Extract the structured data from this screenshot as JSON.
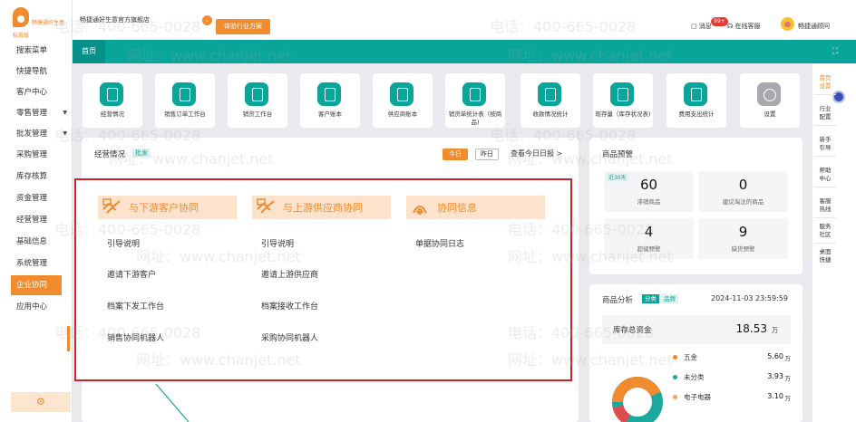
{
  "brand": {
    "name": "畅捷通好生意",
    "sub": "标准版",
    "accent": "#f08b2e",
    "teal": "#0aa59a"
  },
  "sidebar": {
    "items": [
      {
        "label": "搜索菜单",
        "arrow": ""
      },
      {
        "label": "快捷导航",
        "arrow": ""
      },
      {
        "label": "客户中心",
        "arrow": ""
      },
      {
        "label": "零售管理",
        "arrow": "▼"
      },
      {
        "label": "批发管理",
        "arrow": "▼"
      },
      {
        "label": "采购管理",
        "arrow": ""
      },
      {
        "label": "库存核算",
        "arrow": ""
      },
      {
        "label": "资金管理",
        "arrow": ""
      },
      {
        "label": "经营管理",
        "arrow": ""
      },
      {
        "label": "基础信息",
        "arrow": ""
      },
      {
        "label": "系统管理",
        "arrow": ""
      },
      {
        "label": "企业协同",
        "arrow": ""
      },
      {
        "label": "应用中心",
        "arrow": ""
      }
    ],
    "footer_icon": "⚙"
  },
  "topbar": {
    "store": "畅捷通好生意官方旗舰店",
    "caret": "⌄",
    "plan_button": "体验行业方案",
    "messages": "消息",
    "message_badge": "99+",
    "service": "在线客服",
    "username": "畅捷通顾问"
  },
  "tabs": {
    "home": "首页",
    "fullscreen_icon": "⛶"
  },
  "tiles": [
    {
      "label": "经营情况",
      "icon": "report-icon"
    },
    {
      "label": "销售订单工作台",
      "icon": "order-icon"
    },
    {
      "label": "销货工作台",
      "icon": "sales-icon"
    },
    {
      "label": "客户账本",
      "icon": "ledger-icon"
    },
    {
      "label": "供应商账本",
      "icon": "ledger-icon"
    },
    {
      "label": "销货单统计表（按商品)",
      "icon": "stats-icon"
    },
    {
      "label": "收款情况统计",
      "icon": "receipt-icon"
    },
    {
      "label": "现存量（库存状况表)",
      "icon": "inventory-icon"
    },
    {
      "label": "费用支出统计",
      "icon": "expense-icon"
    },
    {
      "label": "设置",
      "icon": "gear-icon"
    }
  ],
  "right_strip": {
    "items": [
      {
        "label": "首页\n设置",
        "active": true
      },
      {
        "label": "行业\n配置",
        "active": false
      },
      {
        "label": "新手\n引导",
        "active": false
      },
      {
        "label": "帮助\n中心",
        "active": false
      },
      {
        "label": "客服\n热线",
        "active": false
      },
      {
        "label": "服务\n社区",
        "active": false
      },
      {
        "label": "桌面\n快捷",
        "active": false
      }
    ]
  },
  "biz": {
    "title": "经营情况",
    "tag": "批发",
    "today": "今日",
    "yesterday": "昨日",
    "report_link": "查看今日日报 >"
  },
  "popup": {
    "columns": [
      {
        "title": "与下游客户协同",
        "links": [
          "引导说明",
          "邀请下游客户",
          "档案下发工作台",
          "销售协同机器人"
        ]
      },
      {
        "title": "与上游供应商协同",
        "links": [
          "引导说明",
          "邀请上游供应商",
          "档案接收工作台",
          "采购协同机器人"
        ]
      },
      {
        "title": "协同信息",
        "links": [
          "单据协同日志"
        ]
      }
    ]
  },
  "warning": {
    "title": "商品预警",
    "tag": "近30天",
    "stats": [
      {
        "value": "60",
        "label": "滞销商品"
      },
      {
        "value": "0",
        "label": "建议淘汰的商品"
      },
      {
        "value": "4",
        "label": "超储预警"
      },
      {
        "value": "9",
        "label": "缺货预警"
      }
    ]
  },
  "analysis": {
    "title": "商品分析",
    "tab_category": "分类",
    "tab_brand": "品牌",
    "date": "2024-11-03 23:59:59",
    "inventory_label": "库存总资金",
    "inventory_value": "18.53",
    "inventory_unit": "万",
    "legend": [
      {
        "name": "五金",
        "value": "5.60",
        "unit": "万",
        "color": "#f08b2e"
      },
      {
        "name": "未分类",
        "value": "3.93",
        "unit": "万",
        "color": "#1ba99d"
      },
      {
        "name": "电子电器",
        "value": "3.10",
        "unit": "万",
        "color": "#f5a25d"
      }
    ]
  },
  "watermark": {
    "phone": "电话：400-665-0028",
    "site": "网址：www.chanjet.net"
  }
}
